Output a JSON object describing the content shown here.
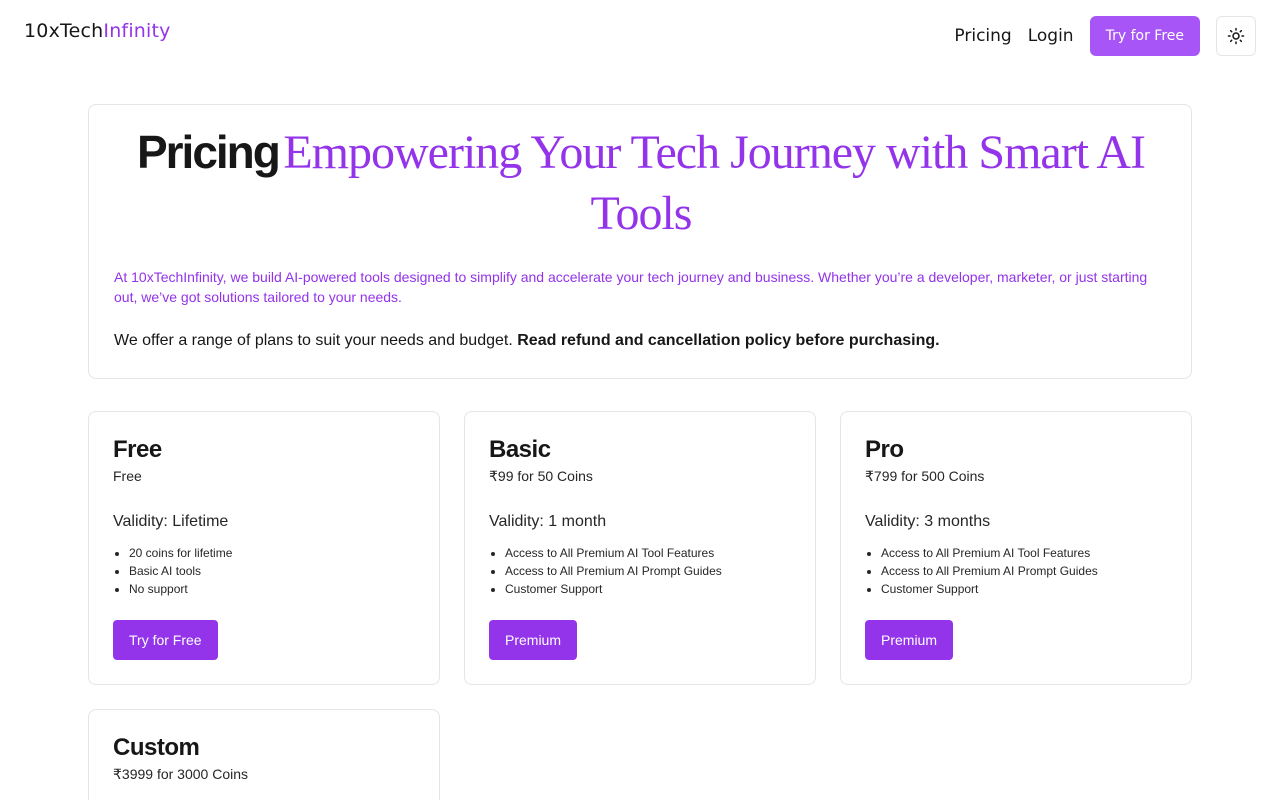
{
  "header": {
    "logo_main": "10xTech",
    "logo_accent": "Infinity",
    "nav": {
      "pricing": "Pricing",
      "login": "Login"
    },
    "cta": "Try for Free",
    "theme_icon": "sun-icon"
  },
  "intro": {
    "title_bold": "Pricing",
    "title_serif": "Empowering Your Tech Journey with Smart AI Tools",
    "description": "At 10xTechInfinity, we build AI-powered tools designed to simplify and accelerate your tech journey and business. Whether you’re a developer, marketer, or just starting out, we’ve got solutions tailored to your needs.",
    "plans_text": "We offer a range of plans to suit your needs and budget.",
    "plans_bold": "Read refund and cancellation policy before purchasing."
  },
  "plans": [
    {
      "name": "Free",
      "price": "Free",
      "validity": "Validity: Lifetime",
      "features": [
        "20 coins for lifetime",
        "Basic AI tools",
        "No support"
      ],
      "button": "Try for Free"
    },
    {
      "name": "Basic",
      "price": "₹99 for 50 Coins",
      "validity": "Validity: 1 month",
      "features": [
        "Access to All Premium AI Tool Features",
        "Access to All Premium AI Prompt Guides",
        "Customer Support"
      ],
      "button": "Premium"
    },
    {
      "name": "Pro",
      "price": "₹799 for 500 Coins",
      "validity": "Validity: 3 months",
      "features": [
        "Access to All Premium AI Tool Features",
        "Access to All Premium AI Prompt Guides",
        "Customer Support"
      ],
      "button": "Premium"
    },
    {
      "name": "Custom",
      "price": "₹3999 for 3000 Coins"
    }
  ],
  "colors": {
    "accent": "#9333ea",
    "accent_light": "#a855f7",
    "border": "#e5e5e5",
    "text": "#171717"
  }
}
